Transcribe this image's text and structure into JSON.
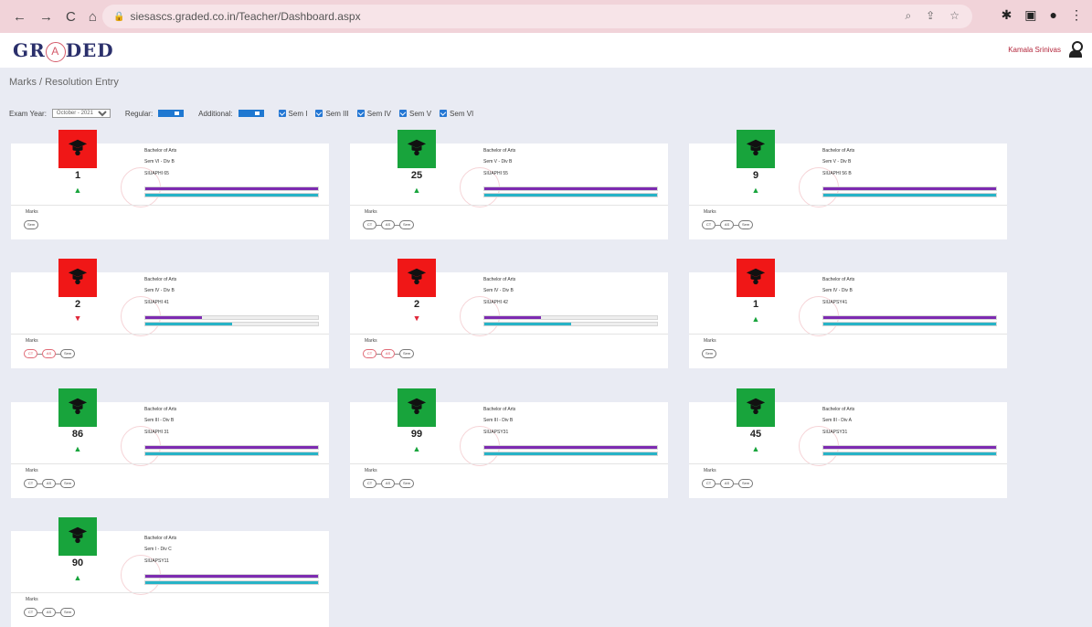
{
  "browser": {
    "url": "siesascs.graded.co.in/Teacher/Dashboard.aspx",
    "back": "←",
    "forward": "→",
    "reload": "C",
    "home": "⌂"
  },
  "app": {
    "logo_left": "GR",
    "logo_mid": "A",
    "logo_right": "DED",
    "user_name": "Kamala Srinivas"
  },
  "page": {
    "breadcrumb": "Marks / Resolution Entry"
  },
  "filters": {
    "exam_year_label": "Exam Year:",
    "exam_year_value": "October - 2021",
    "regular_label": "Regular:",
    "additional_label": "Additional:",
    "semesters": [
      "Sem I",
      "Sem III",
      "Sem IV",
      "Sem V",
      "Sem VI"
    ]
  },
  "cards": [
    {
      "status": "red",
      "count": "1",
      "trend": "up",
      "course": "Bachelor of Arts",
      "sem": "Sem VI - Div B",
      "code": "SIUAPHI 65",
      "purple": 1.0,
      "teal": 1.0,
      "pills": [
        {
          "label": "Sem",
          "state": "normal"
        }
      ]
    },
    {
      "status": "green",
      "count": "25",
      "trend": "up",
      "course": "Bachelor of Arts",
      "sem": "Sem V - Div B",
      "code": "SIUAPHI 55",
      "purple": 1.0,
      "teal": 1.0,
      "pills": [
        {
          "label": "CT",
          "state": "normal"
        },
        {
          "label": "AS",
          "state": "normal"
        },
        {
          "label": "Sem",
          "state": "normal"
        }
      ]
    },
    {
      "status": "green",
      "count": "9",
      "trend": "up",
      "course": "Bachelor of Arts",
      "sem": "Sem V - Div B",
      "code": "SIUAPHI 56 B",
      "purple": 1.0,
      "teal": 1.0,
      "pills": [
        {
          "label": "CT",
          "state": "normal"
        },
        {
          "label": "AS",
          "state": "normal"
        },
        {
          "label": "Sem",
          "state": "normal"
        }
      ]
    },
    {
      "status": "red",
      "count": "2",
      "trend": "down",
      "course": "Bachelor of Arts",
      "sem": "Sem IV - Div B",
      "code": "SIUAPHI 41",
      "purple": 0.33,
      "teal": 0.5,
      "pills": [
        {
          "label": "CT",
          "state": "fail"
        },
        {
          "label": "AS",
          "state": "fail"
        },
        {
          "label": "Sem",
          "state": "normal"
        }
      ]
    },
    {
      "status": "red",
      "count": "2",
      "trend": "down",
      "course": "Bachelor of Arts",
      "sem": "Sem IV - Div B",
      "code": "SIUAPHI 42",
      "purple": 0.33,
      "teal": 0.5,
      "pills": [
        {
          "label": "CT",
          "state": "fail"
        },
        {
          "label": "AS",
          "state": "fail"
        },
        {
          "label": "Sem",
          "state": "normal"
        }
      ]
    },
    {
      "status": "red",
      "count": "1",
      "trend": "up",
      "course": "Bachelor of Arts",
      "sem": "Sem IV - Div B",
      "code": "SIUAPSY41",
      "purple": 1.0,
      "teal": 1.0,
      "pills": [
        {
          "label": "Sem",
          "state": "normal"
        }
      ]
    },
    {
      "status": "green",
      "count": "86",
      "trend": "up",
      "course": "Bachelor of Arts",
      "sem": "Sem III - Div B",
      "code": "SIUAPHI 31",
      "purple": 1.0,
      "teal": 1.0,
      "pills": [
        {
          "label": "CT",
          "state": "normal"
        },
        {
          "label": "AS",
          "state": "normal"
        },
        {
          "label": "Sem",
          "state": "normal"
        }
      ]
    },
    {
      "status": "green",
      "count": "99",
      "trend": "up",
      "course": "Bachelor of Arts",
      "sem": "Sem III - Div B",
      "code": "SIUAPSY31",
      "purple": 1.0,
      "teal": 1.0,
      "pills": [
        {
          "label": "CT",
          "state": "normal"
        },
        {
          "label": "AS",
          "state": "normal"
        },
        {
          "label": "Sem",
          "state": "normal"
        }
      ]
    },
    {
      "status": "green",
      "count": "45",
      "trend": "up",
      "course": "Bachelor of Arts",
      "sem": "Sem III - Div A",
      "code": "SIUAPSY31",
      "purple": 1.0,
      "teal": 1.0,
      "pills": [
        {
          "label": "CT",
          "state": "normal"
        },
        {
          "label": "AS",
          "state": "normal"
        },
        {
          "label": "Sem",
          "state": "normal"
        }
      ]
    },
    {
      "status": "green",
      "count": "90",
      "trend": "up",
      "course": "Bachelor of Arts",
      "sem": "Sem I - Div C",
      "code": "SIUAPSY11",
      "purple": 1.0,
      "teal": 1.0,
      "pills": [
        {
          "label": "CT",
          "state": "normal"
        },
        {
          "label": "AS",
          "state": "normal"
        },
        {
          "label": "Sem",
          "state": "normal"
        }
      ]
    }
  ],
  "card_labels": {
    "marks": "Marks"
  },
  "colors": {
    "success": "#18a43c",
    "danger": "#f01717",
    "purple_bar": "#7d2bb1",
    "teal_bar": "#27b3c7",
    "toggle": "#1f78d1"
  }
}
